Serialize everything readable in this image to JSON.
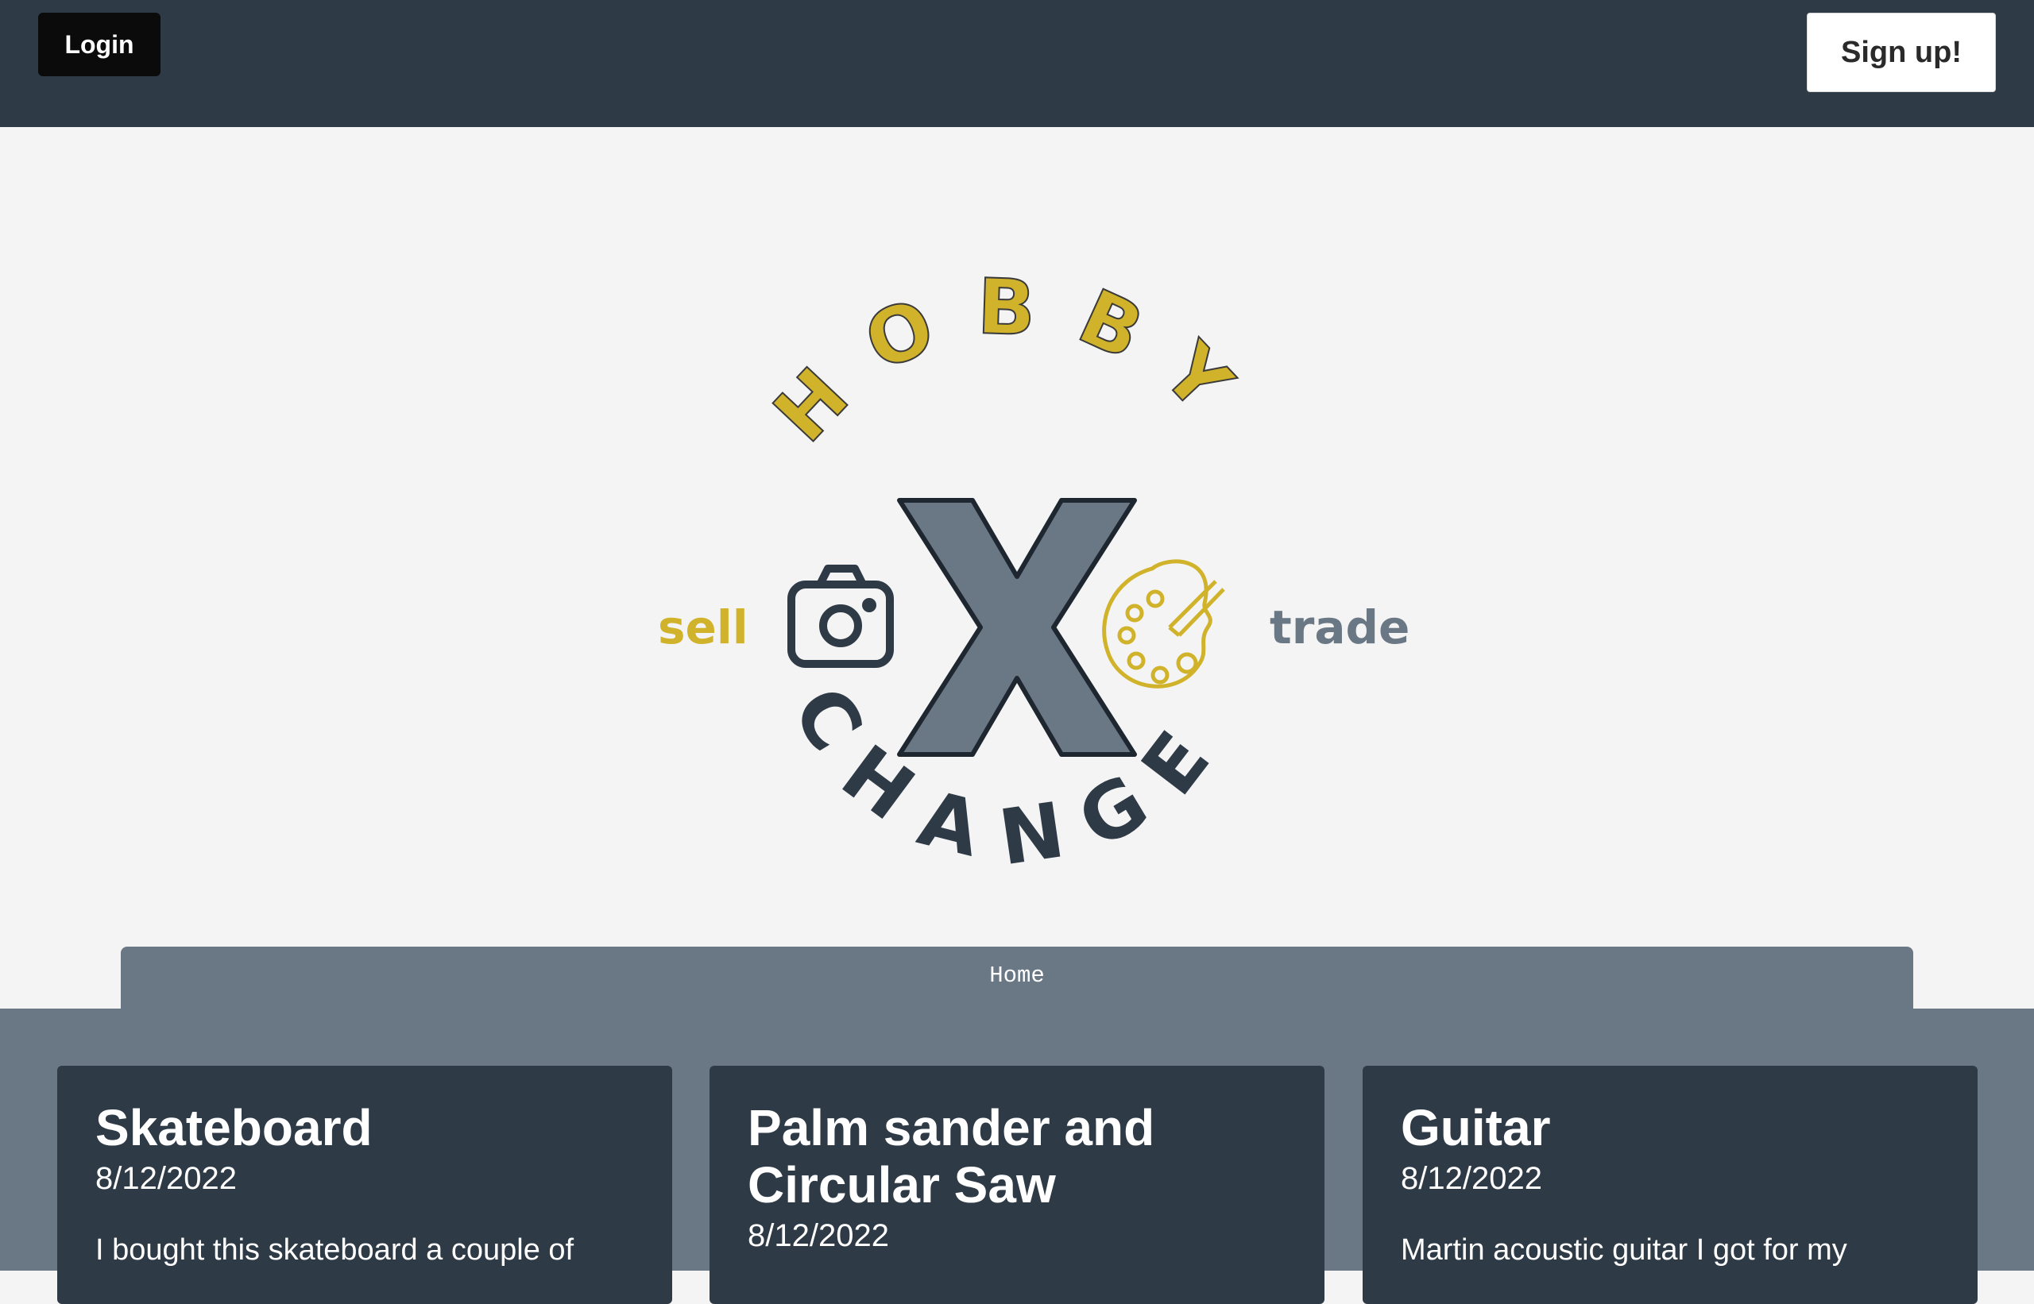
{
  "header": {
    "login_label": "Login",
    "signup_label": "Sign up!"
  },
  "logo": {
    "word_top": "HOBBY",
    "word_bottom": "CHANGE",
    "center_letter": "X",
    "left_word": "sell",
    "right_word": "trade",
    "left_icon": "camera-icon",
    "right_icon": "palette-icon",
    "colors": {
      "gold": "#d0b32a",
      "slate": "#6a7784",
      "dark": "#2e3a46"
    }
  },
  "nav": {
    "home_label": "Home"
  },
  "posts": [
    {
      "title": "Skateboard",
      "date": "8/12/2022",
      "excerpt": "I bought this skateboard a couple of"
    },
    {
      "title_line1": "Palm sander and",
      "title_line2": "Circular Saw",
      "date": "8/12/2022",
      "excerpt": ""
    },
    {
      "title": "Guitar",
      "date": "8/12/2022",
      "excerpt": "Martin acoustic guitar I got for my"
    }
  ]
}
